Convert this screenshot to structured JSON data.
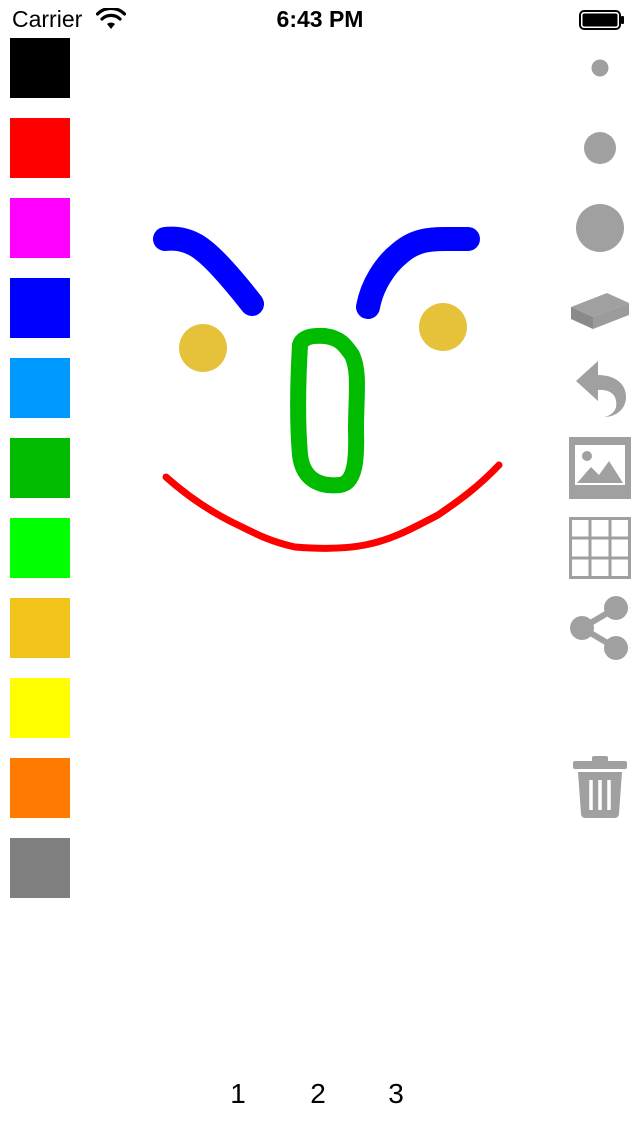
{
  "status_bar": {
    "carrier": "Carrier",
    "time": "6:43 PM"
  },
  "palette": {
    "colors": [
      {
        "name": "black",
        "hex": "#000000"
      },
      {
        "name": "red",
        "hex": "#ff0000"
      },
      {
        "name": "magenta",
        "hex": "#ff00ff"
      },
      {
        "name": "blue",
        "hex": "#0000ff"
      },
      {
        "name": "sky-blue",
        "hex": "#0099ff"
      },
      {
        "name": "green",
        "hex": "#00bb00"
      },
      {
        "name": "lime",
        "hex": "#00ff00"
      },
      {
        "name": "gold",
        "hex": "#f2c31b"
      },
      {
        "name": "yellow",
        "hex": "#ffff00"
      },
      {
        "name": "orange",
        "hex": "#ff7a00"
      },
      {
        "name": "gray",
        "hex": "#808080"
      }
    ]
  },
  "toolbar": {
    "icon_color": "#a0a0a0",
    "tools": [
      "brush-small-icon",
      "brush-medium-icon",
      "brush-large-icon",
      "eraser-icon",
      "undo-icon",
      "image-icon",
      "grid-icon",
      "share-icon",
      "trash-icon"
    ]
  },
  "drawing": {
    "stroke_colors": {
      "eyebrows": "#0000ff",
      "cheeks": "#e6c23a",
      "nose": "#00bb00",
      "mouth": "#ff0000"
    }
  },
  "pages": [
    "1",
    "2",
    "3"
  ]
}
